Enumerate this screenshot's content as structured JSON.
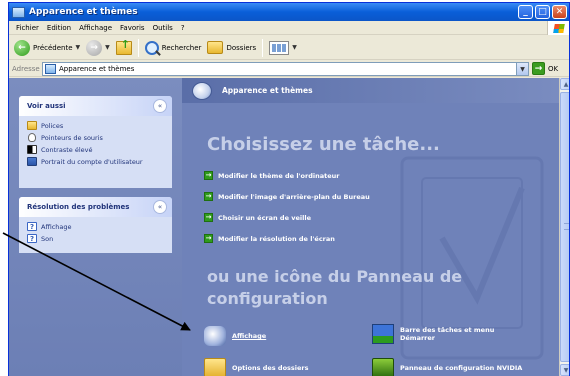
{
  "window": {
    "title": "Apparence et thèmes"
  },
  "menu": [
    "Fichier",
    "Edition",
    "Affichage",
    "Favoris",
    "Outils",
    "?"
  ],
  "toolbar": {
    "back": "Précédente",
    "search": "Rechercher",
    "folders": "Dossiers"
  },
  "address": {
    "label": "Adresse",
    "value": "Apparence et thèmes",
    "go": "OK"
  },
  "sidebar": {
    "see_also": {
      "title": "Voir aussi",
      "collapse": "«",
      "items": [
        "Polices",
        "Pointeurs de souris",
        "Contraste élevé",
        "Portrait du compte d'utilisateur"
      ]
    },
    "troubleshoot": {
      "title": "Résolution des problèmes",
      "collapse": "«",
      "items": [
        "Affichage",
        "Son"
      ]
    }
  },
  "main": {
    "header": "Apparence et thèmes",
    "pick_task": "Choisissez une tâche...",
    "tasks": [
      "Modifier le thème de l'ordinateur",
      "Modifier l'image d'arrière-plan du Bureau",
      "Choisir un écran de veille",
      "Modifier la résolution de l'écran"
    ],
    "or_icon": "ou une icône du Panneau de configuration",
    "icons": [
      {
        "label": "Affichage"
      },
      {
        "label": "Barre des tâches et menu Démarrer"
      },
      {
        "label": "Options des dossiers"
      },
      {
        "label": "Panneau de configuration NVIDIA"
      }
    ]
  },
  "colors": {
    "titlebar": "#0a5fd8",
    "content_bg": "#7083b8",
    "task_arrow": "#2f9c1c"
  },
  "icons": {
    "window": "folder-window-icon",
    "back": "back-arrow-icon",
    "forward": "forward-arrow-icon",
    "up": "folder-up-icon",
    "search": "magnifier-icon",
    "folders": "folders-icon",
    "views": "views-icon",
    "go": "go-arrow-icon"
  }
}
